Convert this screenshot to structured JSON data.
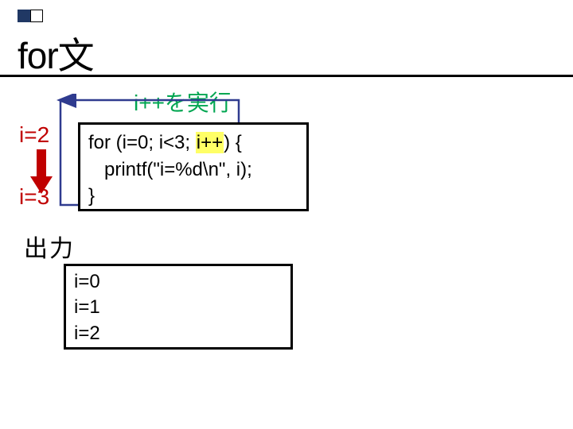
{
  "title": "for文",
  "exec_label": "i++を実行",
  "i_before": "i=2",
  "i_after": "i=3",
  "code": {
    "line1_pre": "for (i=0; i<3; ",
    "line1_hl": "i++",
    "line1_post": ") {",
    "line2": "   printf(\"i=%d\\n\", i);",
    "line3": "}"
  },
  "output_label": "出力",
  "output": {
    "line1": "i=0",
    "line2": "i=1",
    "line3": "i=2"
  }
}
